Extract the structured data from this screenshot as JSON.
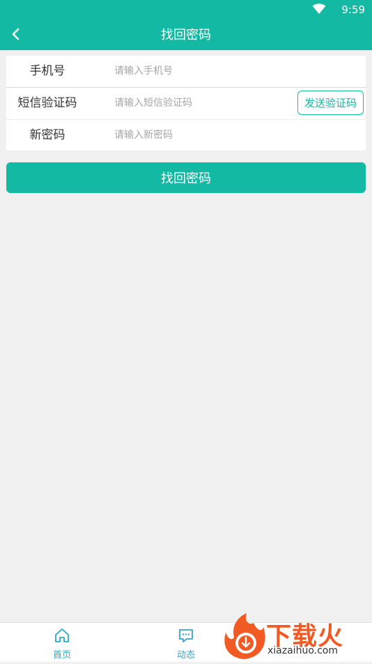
{
  "status": {
    "time": "9:59"
  },
  "header": {
    "title": "找回密码"
  },
  "form": {
    "phone": {
      "label": "手机号",
      "placeholder": "请输入手机号",
      "value": ""
    },
    "sms": {
      "label": "短信验证码",
      "placeholder": "请输入短信验证码",
      "value": "",
      "button": "发送验证码"
    },
    "password": {
      "label": "新密码",
      "placeholder": "请输入新密码",
      "value": ""
    }
  },
  "submit": {
    "label": "找回密码"
  },
  "tabbar": {
    "items": [
      {
        "label": "首页",
        "icon": "home-icon"
      },
      {
        "label": "动态",
        "icon": "chat-bubble-icon"
      }
    ]
  },
  "watermark": {
    "text": "下载火",
    "url": "xiazaihuo.com"
  },
  "colors": {
    "accent": "#13b9a2",
    "tab_active": "#28a9c7",
    "watermark": "#f25a24"
  }
}
